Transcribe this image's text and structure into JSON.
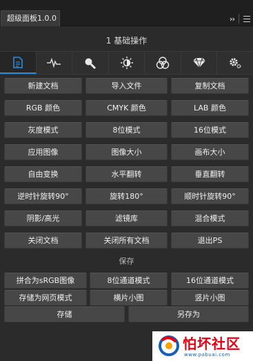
{
  "panel": {
    "tab_title": "超级面板1.0.0",
    "expand_label": "››"
  },
  "section": {
    "title": "1 基础操作"
  },
  "tool_icons": [
    "document-icon",
    "waveform-icon",
    "magnifier-icon",
    "brightness-icon",
    "color-circles-icon",
    "diamond-icon",
    "gear-icon"
  ],
  "buttons": {
    "row1": [
      "新建文档",
      "导入文件",
      "复制文档"
    ],
    "row2": [
      "RGB 颜色",
      "CMYK 颜色",
      "LAB 颜色"
    ],
    "row3": [
      "灰度模式",
      "8位模式",
      "16位模式"
    ],
    "row4": [
      "应用图像",
      "图像大小",
      "画布大小"
    ],
    "row5": [
      "自由变换",
      "水平翻转",
      "垂直翻转"
    ],
    "row6": [
      "逆时针旋转90°",
      "旋转180°",
      "顺时针旋转90°"
    ],
    "row7": [
      "阴影/高光",
      "滤镜库",
      "混合模式"
    ],
    "row8": [
      "关闭文档",
      "关闭所有文档",
      "退出PS"
    ]
  },
  "save": {
    "label": "保存",
    "row1": [
      "拼合为sRGB图像",
      "8位通道模式",
      "16位通道模式"
    ],
    "row2": [
      "存储为网页模式",
      "横片小图",
      "竖片小图"
    ],
    "row3": [
      "存储",
      "另存为"
    ]
  },
  "watermark": {
    "text": "怕坏社区",
    "sub": "www.pabuai.com"
  },
  "colors": {
    "background": "#2b2b2b",
    "button": "#474747",
    "accent": "#2a8ddc"
  }
}
